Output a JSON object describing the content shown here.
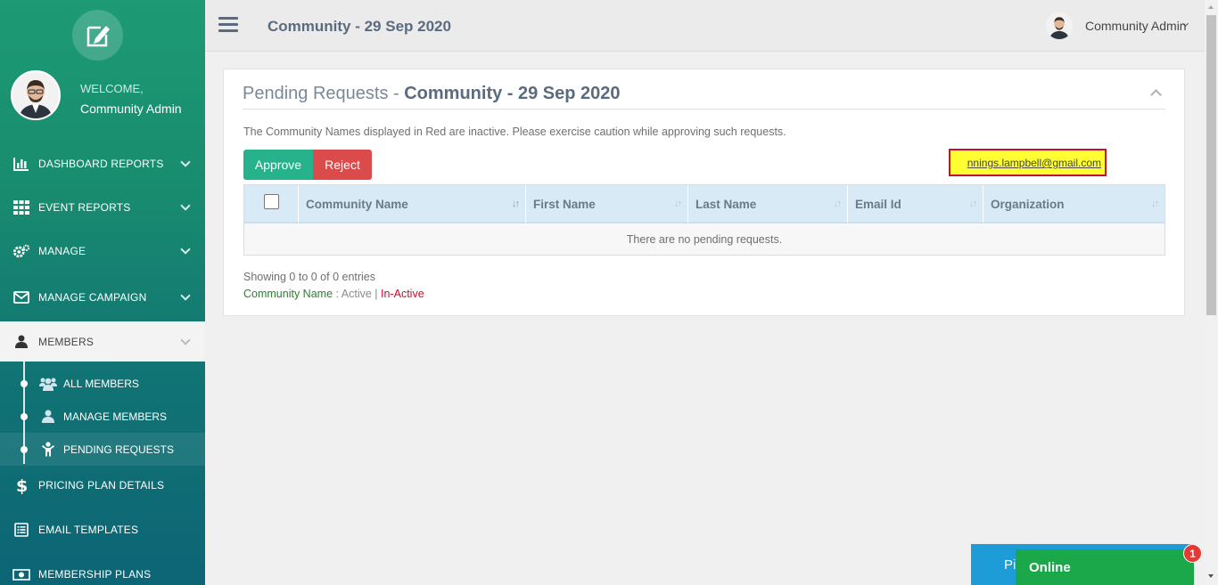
{
  "sidebar": {
    "welcome": "WELCOME,",
    "user_name": "Community Admin",
    "items": [
      {
        "label": "DASHBOARD REPORTS",
        "icon": "bar-chart-icon"
      },
      {
        "label": "EVENT REPORTS",
        "icon": "grid-icon"
      },
      {
        "label": "MANAGE",
        "icon": "gears-icon"
      },
      {
        "label": "MANAGE CAMPAIGN",
        "icon": "envelope-icon"
      },
      {
        "label": "MEMBERS",
        "icon": "user-icon"
      },
      {
        "label": "PRICING PLAN DETAILS",
        "icon": "dollar-icon"
      },
      {
        "label": "EMAIL TEMPLATES",
        "icon": "list-alt-icon"
      },
      {
        "label": "MEMBERSHIP PLANS",
        "icon": "money-icon"
      }
    ],
    "members_sub": [
      {
        "label": "ALL MEMBERS",
        "icon": "users-icon"
      },
      {
        "label": "MANAGE MEMBERS",
        "icon": "user-icon"
      },
      {
        "label": "PENDING REQUESTS",
        "icon": "child-icon"
      }
    ]
  },
  "topbar": {
    "title": "Community - 29 Sep 2020",
    "user": "Community Admin"
  },
  "panel": {
    "title_prefix": "Pending Requests - ",
    "title_bold": "Community - 29 Sep 2020",
    "notice": "The Community Names displayed in Red are inactive. Please exercise caution while approving such requests.",
    "approve_label": "Approve",
    "reject_label": "Reject",
    "email_overlay": "nnings.lampbell@gmail.com",
    "columns": [
      "Community Name",
      "First Name",
      "Last Name",
      "Email Id",
      "Organization"
    ],
    "empty_message": "There are no pending requests.",
    "showing": "Showing 0 to 0 of 0 entries",
    "legend": {
      "name": "Community Name",
      "sep1": " : ",
      "active": "Active",
      "sep2": " | ",
      "inactive": "In-Active"
    }
  },
  "widgets": {
    "promo_label": "Pi",
    "online_label": "Online",
    "badge_count": "1"
  },
  "colors": {
    "sidebar_top": "#1d9b73",
    "sidebar_bottom": "#0c6575",
    "approve": "#26b38c",
    "reject": "#dc4b4b",
    "online": "#1aa84a"
  }
}
